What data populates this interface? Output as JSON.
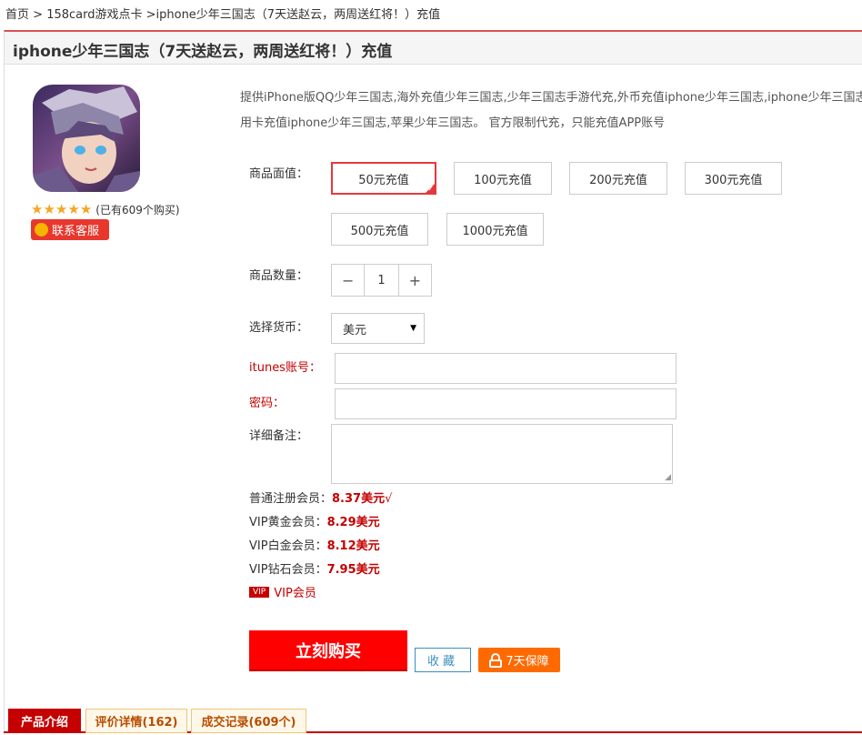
{
  "breadcrumb": {
    "home": "首页",
    "sep1": " > ",
    "category": "158card游戏点卡",
    "sep2": " >",
    "current": "iphone少年三国志（7天送赵云，两周送红将！）充值"
  },
  "page_title": "iphone少年三国志（7天送赵云，两周送红将！）充值",
  "product": {
    "rating_stars": 5,
    "sold_text": "(已有609个购买)",
    "contact_label": "联系客服",
    "desc_line1": "提供iPhone版QQ少年三国志,海外充值少年三国志,少年三国志手游代充,外币充值iphone少年三国志,iphone少年三国志,信",
    "desc_line2": "用卡充值iphone少年三国志,苹果少年三国志。 官方限制代充，只能充值APP账号"
  },
  "form": {
    "denomination_label": "商品面值：",
    "denominations": [
      "50元充值",
      "100元充值",
      "200元充值",
      "300元充值",
      "500元充值",
      "1000元充值"
    ],
    "selected_denomination": "50元充值",
    "quantity_label": "商品数量：",
    "quantity_minus": "−",
    "quantity_value": "1",
    "quantity_plus": "+",
    "currency_label": "选择货币：",
    "currency_value": "美元",
    "account_label": "itunes账号：",
    "password_label": "密码：",
    "remark_label": "详细备注："
  },
  "prices": {
    "normal_label": "普通注册会员：",
    "normal_value": "8.37美元",
    "normal_tick": "√",
    "gold_label": "VIP黄金会员：",
    "gold_value": "8.29美元",
    "platinum_label": "VIP白金会员：",
    "platinum_value": "8.12美元",
    "diamond_label": "VIP钻石会员：",
    "diamond_value": "7.95美元",
    "vip_badge": "VIP",
    "vip_link": "VIP会员"
  },
  "actions": {
    "buy_label": "立刻购买",
    "fav_label": "收藏",
    "guarantee_label": "7天保障"
  },
  "tabs": [
    "产品介绍",
    "评价详情(162)",
    "成交记录(609个)"
  ],
  "colors": {
    "accent_red": "#e4393c",
    "buy_red": "#ff0000",
    "price_red": "#c40000",
    "guarantee_orange": "#ff6a00"
  }
}
